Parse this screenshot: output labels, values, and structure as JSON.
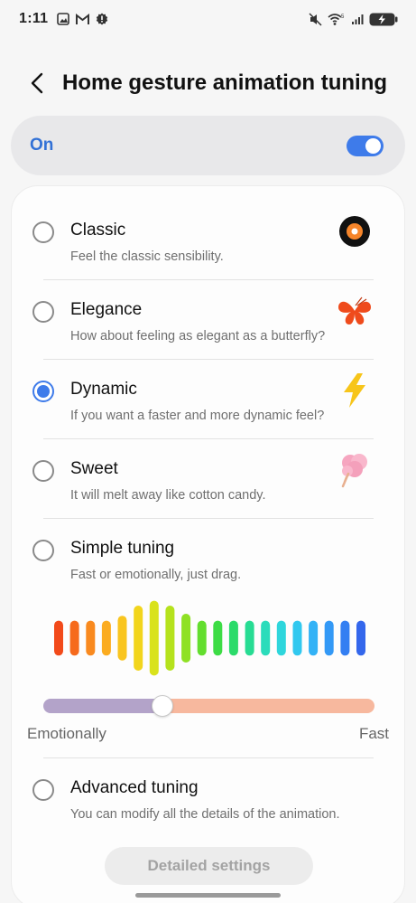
{
  "status_bar": {
    "time": "1:11",
    "left_icons": [
      "gallery-icon",
      "gmail-icon",
      "settings-badge-icon"
    ],
    "right_icons": [
      "mute-icon",
      "wifi-icon",
      "signal-icon",
      "battery-charging-icon"
    ],
    "wifi_label": "5"
  },
  "header": {
    "title": "Home gesture animation tuning",
    "back_icon": "chevron-left-icon"
  },
  "master_toggle": {
    "label": "On",
    "checked": true
  },
  "options": [
    {
      "id": "classic",
      "title": "Classic",
      "subtitle": "Feel the classic sensibility.",
      "icon": "record-icon",
      "selected": false
    },
    {
      "id": "elegance",
      "title": "Elegance",
      "subtitle": "How about feeling as elegant as a butterfly?",
      "icon": "butterfly-icon",
      "selected": false
    },
    {
      "id": "dynamic",
      "title": "Dynamic",
      "subtitle": "If you want a faster and more dynamic feel?",
      "icon": "lightning-icon",
      "selected": true
    },
    {
      "id": "sweet",
      "title": "Sweet",
      "subtitle": "It will melt away like cotton candy.",
      "icon": "cotton-candy-icon",
      "selected": false
    },
    {
      "id": "simple",
      "title": "Simple tuning",
      "subtitle": "Fast or emotionally, just drag.",
      "selected": false
    },
    {
      "id": "advanced",
      "title": "Advanced tuning",
      "subtitle": "You can modify all the details of the animation.",
      "selected": false
    }
  ],
  "simple_tuning": {
    "slider_min_label": "Emotionally",
    "slider_max_label": "Fast",
    "slider_value": 0.36,
    "wave_colors": [
      "#f24a1a",
      "#f66a1c",
      "#f98a1f",
      "#fbac20",
      "#f9c51f",
      "#f2d51c",
      "#d9e21b",
      "#b5e21d",
      "#8fe124",
      "#63de2e",
      "#3ddc45",
      "#2bdb6a",
      "#27dc93",
      "#2bdcbb",
      "#2ed6dc",
      "#31c8ef",
      "#32b2f6",
      "#3399f6",
      "#347ff2",
      "#3467ec"
    ],
    "wave_levels": [
      0.43,
      0.43,
      0.43,
      0.43,
      0.55,
      0.8,
      0.92,
      0.8,
      0.6,
      0.43,
      0.43,
      0.43,
      0.43,
      0.43,
      0.43,
      0.43,
      0.43,
      0.43,
      0.43,
      0.43
    ]
  },
  "detailed_settings_button": "Detailed settings"
}
